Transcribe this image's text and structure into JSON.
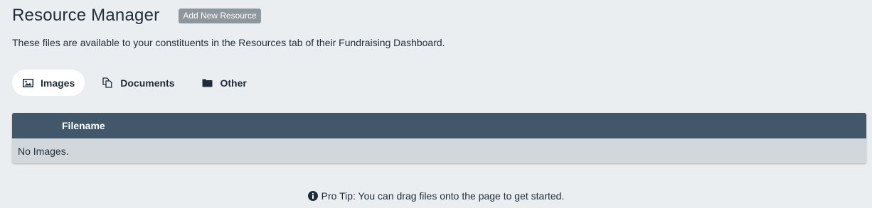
{
  "header": {
    "title": "Resource Manager",
    "add_button_label": "Add New Resource"
  },
  "description": "These files are available to your constituents in the Resources tab of their Fundraising Dashboard.",
  "tabs": [
    {
      "label": "Images",
      "icon": "image-icon",
      "active": true
    },
    {
      "label": "Documents",
      "icon": "documents-icon",
      "active": false
    },
    {
      "label": "Other",
      "icon": "folder-icon",
      "active": false
    }
  ],
  "table": {
    "columns": [
      "Filename"
    ],
    "empty_message": "No Images."
  },
  "protip": {
    "icon": "info-icon",
    "text": "Pro Tip: You can drag files onto the page to get started."
  },
  "colors": {
    "background": "#ebeef0",
    "header_row": "#42586a",
    "empty_row": "#d1d7db",
    "button": "#8f979e",
    "text": "#1f2d3a"
  }
}
